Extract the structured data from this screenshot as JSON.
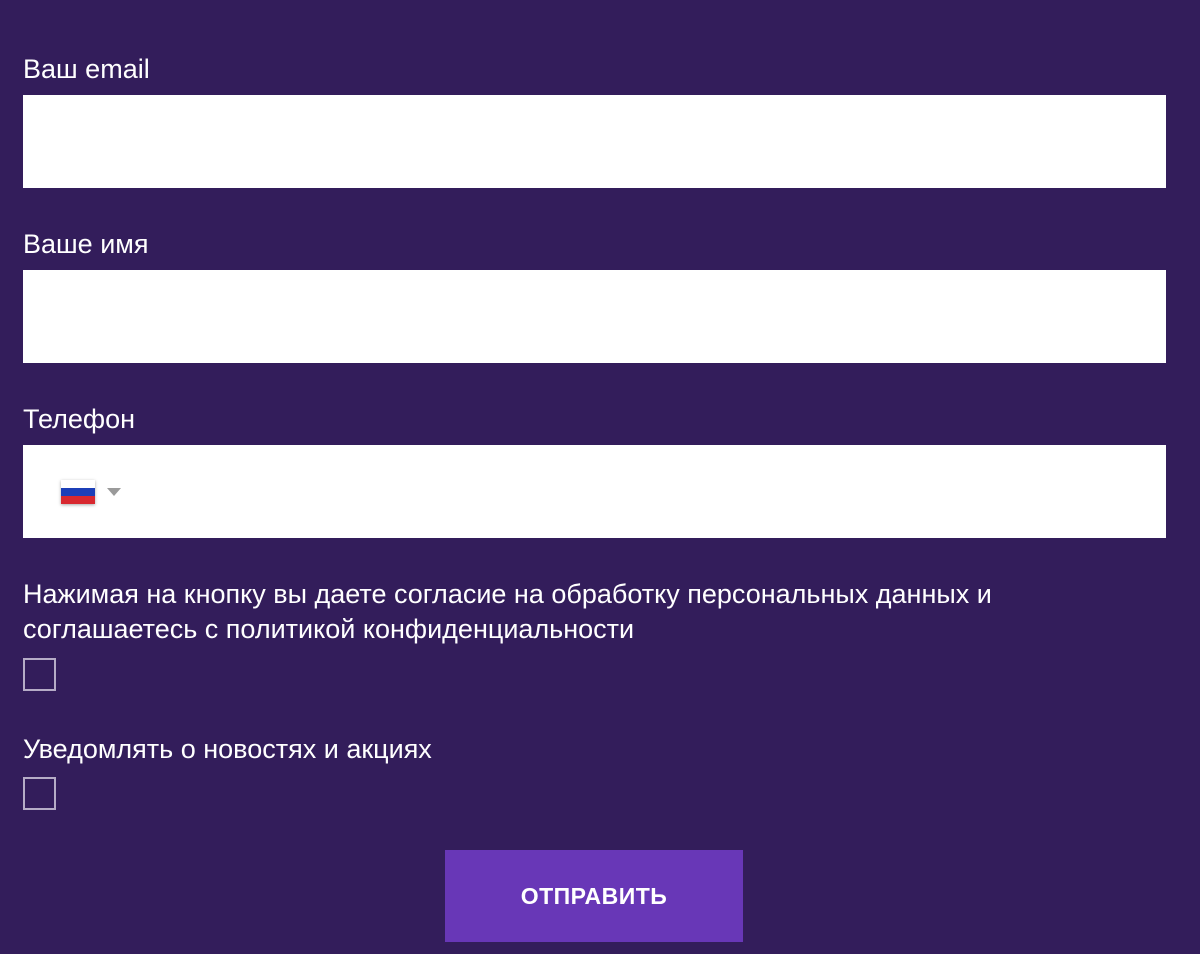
{
  "form": {
    "email": {
      "label": "Ваш email",
      "value": "",
      "placeholder": ""
    },
    "name": {
      "label": "Ваше имя",
      "value": "",
      "placeholder": ""
    },
    "phone": {
      "label": "Телефон",
      "value": "",
      "placeholder": "",
      "country_icon": "russia-flag-icon",
      "flag_colors": [
        "#ffffff",
        "#1c3fb8",
        "#d8282f"
      ],
      "dropdown_icon": "chevron-down-icon"
    },
    "consent": {
      "text": "Нажимая на кнопку вы даете согласие на обработку персональных данных и соглашаетесь с политикой конфиденциальности",
      "checked": false
    },
    "newsletter": {
      "text": "Уведомлять о новостях и акциях",
      "checked": false
    },
    "submit_label": "ОТПРАВИТЬ"
  },
  "colors": {
    "background": "#331d5b",
    "field_background": "#ffffff",
    "button": "#6837b7",
    "checkbox_border": "#b6acc7",
    "text": "#ffffff"
  }
}
